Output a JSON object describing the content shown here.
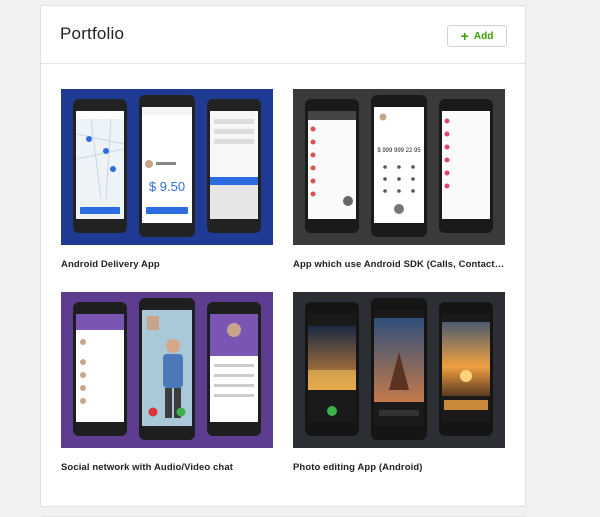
{
  "portfolio": {
    "title": "Portfolio",
    "add_label": "Add",
    "items": [
      {
        "title": "Android Delivery App",
        "bg": "#1f3a93",
        "price": "$ 9.50"
      },
      {
        "title": "App which use Android SDK (Calls, Contacts, ...",
        "bg": "#3a3a3a",
        "phone_number": "$ 999 999 22 95"
      },
      {
        "title": "Social network with Audio/Video chat",
        "bg": "#5d3d8f"
      },
      {
        "title": "Photo editing App (Android)",
        "bg": "#2b2e33"
      }
    ]
  },
  "colors": {
    "accent_green": "#37a000",
    "delivery_blue": "#1f3a93",
    "social_purple": "#5d3d8f"
  }
}
